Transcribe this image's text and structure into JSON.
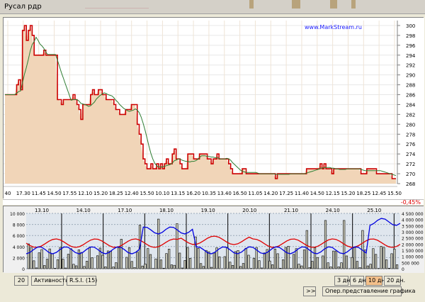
{
  "window": {
    "title": "Русал рдр"
  },
  "main_chart": {
    "watermark": "www.MarkStream.ru",
    "change": "-0,45%",
    "y_ticks": [
      300,
      298,
      296,
      294,
      292,
      290,
      288,
      286,
      284,
      282,
      280,
      278,
      276,
      274,
      272,
      270,
      268
    ],
    "x_labels": [
      "40",
      "17.30",
      "11.45",
      "14.50",
      "17.55",
      "12.10",
      "15.20",
      "18.25",
      "12.40",
      "15.50",
      "10.10",
      "13.15",
      "16.20",
      "10.35",
      "13.40",
      "16.50",
      "11.05",
      "14.20",
      "17.25",
      "11.40",
      "14.50",
      "12.15",
      "15.20",
      "18.25",
      "12.45",
      "15.50"
    ]
  },
  "lower_chart": {
    "dates": [
      "13.10",
      "14.10",
      "17.10",
      "18.10",
      "19.10",
      "20.10",
      "21.10",
      "24.10",
      "25.10"
    ],
    "left_ticks": [
      "10 000",
      "8 000",
      "6 000",
      "4 000",
      "2 000",
      "0"
    ],
    "right_ticks": [
      "4 500 000",
      "4 000 000",
      "3 500 000",
      "3 000 000",
      "2 500 000",
      "2 000 000",
      "1 500 000",
      "1 000 000",
      "500 000",
      "0"
    ]
  },
  "controls": {
    "period_value": "20",
    "activity_label": "Активность",
    "rsi_label": "R.S.I. (15)",
    "scroll_label": ">>",
    "range_3": "3 дн.",
    "range_6": "6 дн.",
    "range_10": "10 дн.",
    "range_20": "20 дн.",
    "oper_label": "Опер.представление графика"
  },
  "chart_data": {
    "type": "line",
    "title": "Русал рдр",
    "ylim": [
      268,
      301
    ],
    "series": [
      {
        "values": [
          286,
          286,
          286,
          286,
          286,
          286,
          288,
          289,
          287,
          299,
          300,
          297,
          299,
          300,
          298,
          294,
          294,
          294,
          294,
          294,
          295,
          294,
          294,
          294,
          294,
          294,
          294,
          285,
          285,
          284,
          285,
          285,
          285,
          285,
          285,
          286,
          285,
          284,
          283,
          281,
          284,
          284,
          284,
          284,
          286,
          287,
          286,
          286,
          287,
          287,
          286,
          286,
          285,
          285,
          285,
          285,
          284,
          283,
          283,
          282,
          282,
          282,
          283,
          283,
          283,
          284,
          284,
          284,
          280,
          278,
          276,
          273,
          272,
          271,
          271,
          272,
          271,
          271,
          272,
          271,
          272,
          271,
          272,
          273,
          272,
          272,
          274,
          275,
          273,
          273,
          272,
          271,
          271,
          271,
          274,
          274,
          274,
          273,
          273,
          273,
          274,
          274,
          274,
          274,
          273,
          273,
          272,
          273,
          273,
          274,
          273,
          273,
          273,
          273,
          273,
          272,
          271,
          270,
          270,
          270,
          270,
          270,
          271,
          271,
          270,
          270,
          270,
          270,
          270,
          270,
          270,
          270,
          270,
          270,
          270,
          270,
          270,
          270,
          270,
          269,
          270,
          270,
          270,
          270,
          270,
          270,
          270,
          270,
          270,
          270,
          270,
          270,
          270,
          270,
          270,
          271,
          271,
          271,
          271,
          271,
          271,
          271,
          272,
          271,
          272,
          271,
          271,
          271,
          270,
          271,
          271,
          271,
          271,
          271,
          271,
          271,
          271,
          271,
          271,
          271,
          271,
          271,
          271,
          270,
          270,
          270,
          271,
          271,
          271,
          271,
          271,
          270,
          270,
          270,
          270,
          270,
          270,
          270,
          270,
          269,
          269,
          269
        ]
      }
    ]
  }
}
